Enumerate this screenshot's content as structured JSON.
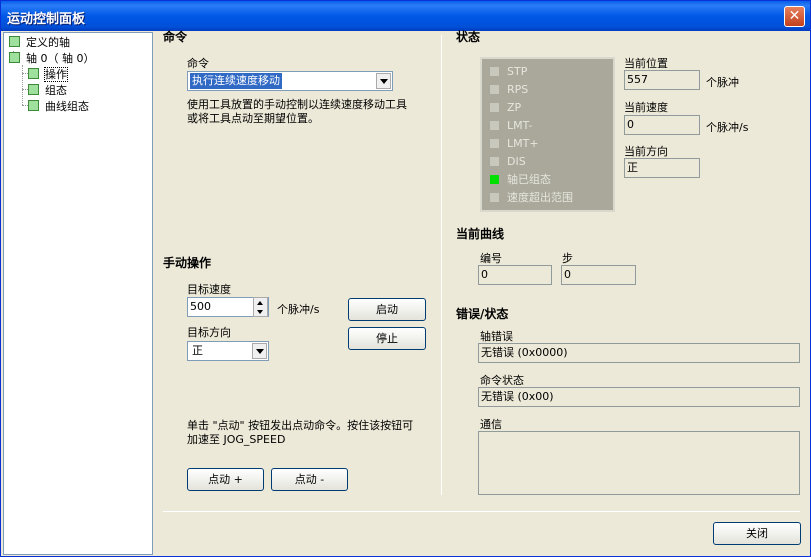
{
  "window": {
    "title": "运动控制面板",
    "close_glyph": "✕"
  },
  "tree": {
    "items": [
      {
        "label": "定义的轴"
      },
      {
        "label": "轴 0（ 轴 0）"
      },
      {
        "label": "操作"
      },
      {
        "label": "组态"
      },
      {
        "label": "曲线组态"
      }
    ]
  },
  "command": {
    "section": "命令",
    "label": "命令",
    "selected": "执行连续速度移动",
    "description": "使用工具放置的手动控制以连续速度移动工具\n或将工具点动至期望位置。"
  },
  "manual": {
    "section": "手动操作",
    "target_speed_label": "目标速度",
    "target_speed_value": "500",
    "speed_unit": "个脉冲/s",
    "target_dir_label": "目标方向",
    "target_dir_value": "正",
    "start_button": "启动",
    "stop_button": "停止",
    "jog_note": "单击 \"点动\" 按钮发出点动命令。按住该按钮可\n加速至 JOG_SPEED",
    "jog_plus": "点动 +",
    "jog_minus": "点动 -"
  },
  "status": {
    "section": "状态",
    "leds": [
      {
        "label": "STP",
        "on": false
      },
      {
        "label": "RPS",
        "on": false
      },
      {
        "label": "ZP",
        "on": false
      },
      {
        "label": "LMT-",
        "on": false
      },
      {
        "label": "LMT+",
        "on": false
      },
      {
        "label": "DIS",
        "on": false
      },
      {
        "label": "轴已组态",
        "on": true
      },
      {
        "label": "速度超出范围",
        "on": false
      }
    ],
    "led_on_color": "#00e000",
    "position_label": "当前位置",
    "position_value": "557",
    "position_unit": "个脉冲",
    "speed_label": "当前速度",
    "speed_value": "0",
    "speed_unit": "个脉冲/s",
    "direction_label": "当前方向",
    "direction_value": "正"
  },
  "curve": {
    "section": "当前曲线",
    "number_label": "编号",
    "number_value": "0",
    "step_label": "步",
    "step_value": "0"
  },
  "errors": {
    "section": "错误/状态",
    "axis_error_label": "轴错误",
    "axis_error_value": "无错误 (0x0000)",
    "cmd_status_label": "命令状态",
    "cmd_status_value": "无错误 (0x00)",
    "comm_label": "通信",
    "comm_value": ""
  },
  "footer": {
    "close_button": "关闭"
  }
}
